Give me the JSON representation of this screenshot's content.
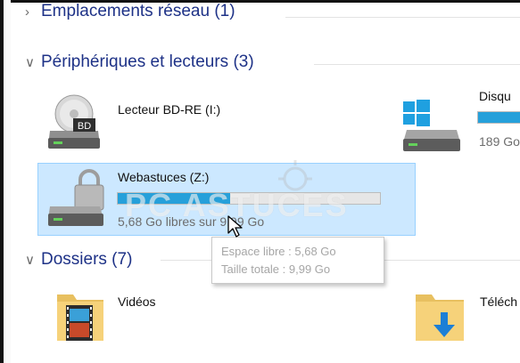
{
  "groups": {
    "network": "Emplacements réseau (1)",
    "devices": "Périphériques et lecteurs (3)",
    "folders": "Dossiers (7)"
  },
  "drives": [
    {
      "title": "Lecteur BD-RE (I:)",
      "badge": "BD",
      "icon": "bd-drive-icon"
    },
    {
      "title": "Webastuces (Z:)",
      "sub": "5,68 Go libres sur 9,99 Go",
      "used_fraction": 0.43,
      "icon": "locked-drive-icon"
    },
    {
      "title": "Disqu",
      "sub": "189 Go",
      "icon": "windows-drive-icon"
    }
  ],
  "folders": [
    {
      "label": "Vidéos",
      "icon": "videos-folder-icon"
    },
    {
      "label": "Téléch",
      "icon": "downloads-folder-icon"
    }
  ],
  "tooltip": {
    "line1": "Espace libre : 5,68 Go",
    "line2": "Taille totale : 9,99 Go"
  },
  "watermark": "PC ASTUCES",
  "colors": {
    "group_header": "#1e3287",
    "bar_fill": "#26a0da",
    "selection": "#cce8ff"
  }
}
